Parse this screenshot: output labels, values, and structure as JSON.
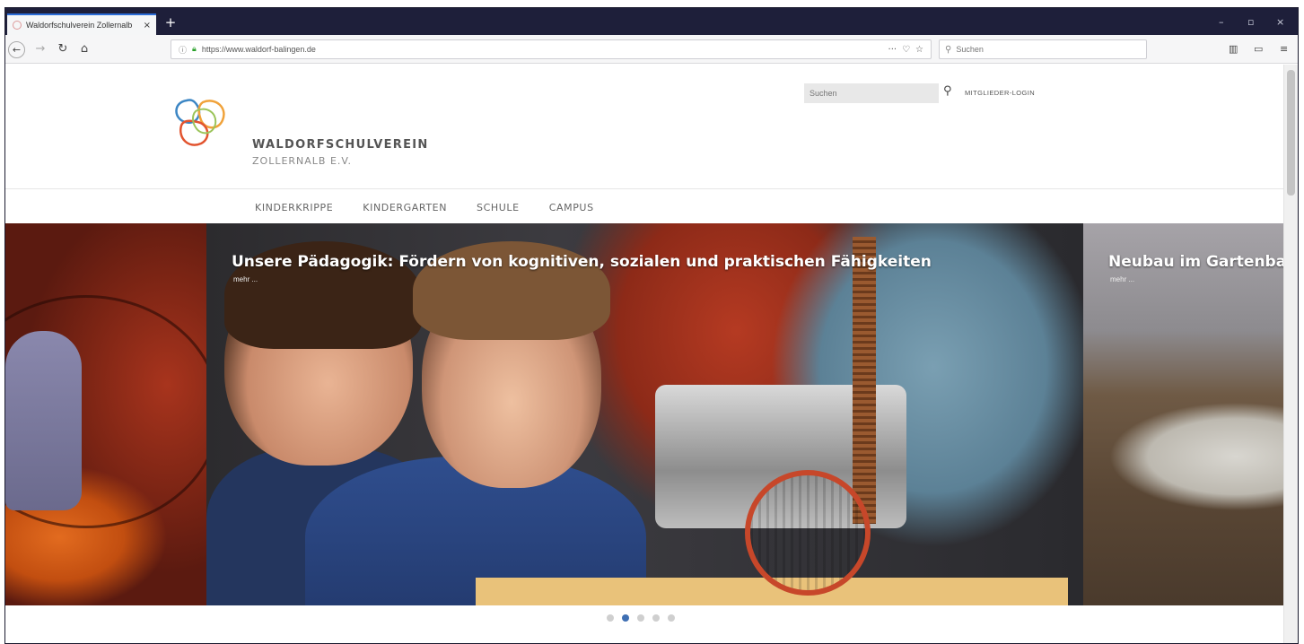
{
  "browser": {
    "tab_title": "Waldorfschulverein Zollernalb",
    "tab_close": "×",
    "new_tab": "+",
    "window_controls": {
      "minimize": "–",
      "restore": "▫",
      "close": "×"
    },
    "url": "https://www.waldorf-balingen.de",
    "search_placeholder": "Suchen",
    "icons": [
      "back-icon",
      "forward-icon",
      "reload-icon",
      "home-icon",
      "info-icon",
      "lock-icon",
      "page-actions-icon",
      "pocket-icon",
      "bookmark-star-icon",
      "search-icon",
      "library-icon",
      "sidebar-icon",
      "menu-icon"
    ]
  },
  "site": {
    "org_name_line1": "WALDORFSCHULVEREIN",
    "org_name_line2": "ZOLLERNALB E.V.",
    "search_placeholder": "Suchen",
    "login_label": "MITGLIEDER-LOGIN",
    "nav": [
      {
        "label": "KINDERKRIPPE"
      },
      {
        "label": "KINDERGARTEN"
      },
      {
        "label": "SCHULE"
      },
      {
        "label": "CAMPUS"
      }
    ],
    "logo_colors": [
      "#3c86c4",
      "#f0a23a",
      "#e2542f",
      "#9bc45a"
    ]
  },
  "slider": {
    "slides": [
      {
        "caption": "Unsere Pädagogik: Fördern von kognitiven, sozialen und praktischen Fähigkeiten",
        "more": "mehr ..."
      },
      {
        "caption": "Neubau im Gartenbau",
        "more": "mehr ..."
      }
    ],
    "dot_count": 5,
    "active_dot": 2
  }
}
